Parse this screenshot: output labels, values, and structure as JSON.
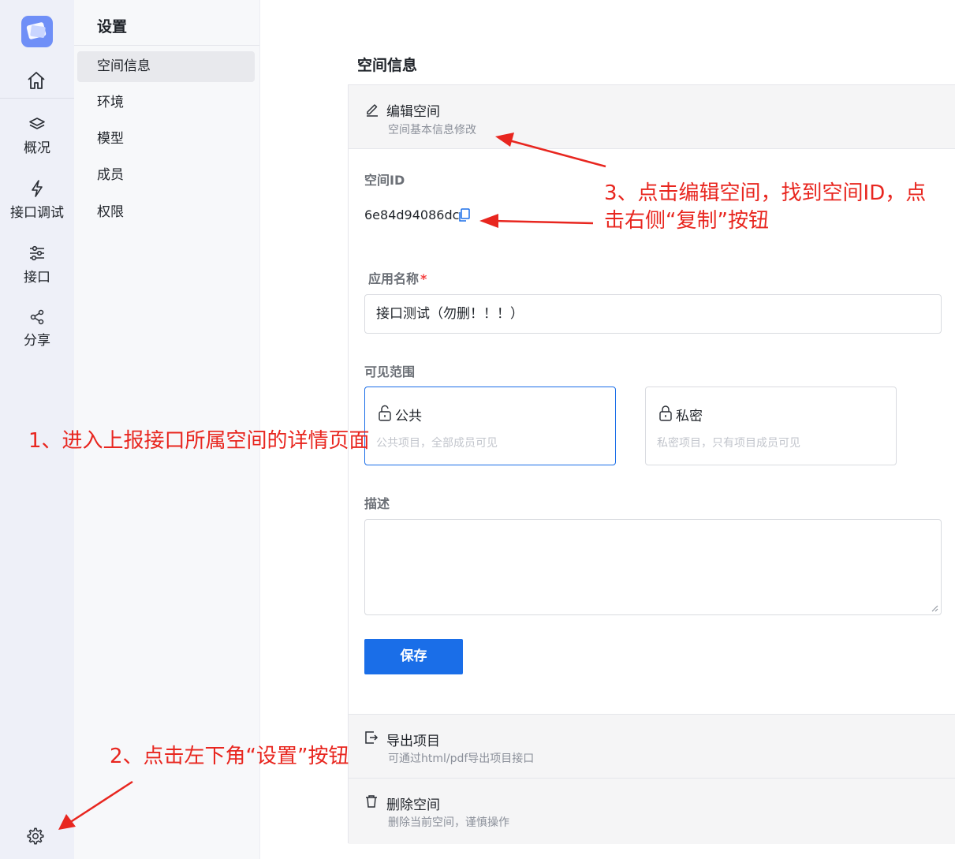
{
  "rail": {
    "items": [
      {
        "icon": "layers-icon",
        "label": "概况"
      },
      {
        "icon": "lightning-icon",
        "label": "接口调试"
      },
      {
        "icon": "sliders-icon",
        "label": "接口"
      },
      {
        "icon": "share-icon",
        "label": "分享"
      }
    ]
  },
  "submenu": {
    "title": "设置",
    "items": [
      {
        "label": "空间信息",
        "active": true
      },
      {
        "label": "环境"
      },
      {
        "label": "模型"
      },
      {
        "label": "成员"
      },
      {
        "label": "权限"
      }
    ]
  },
  "main": {
    "page_title": "空间信息",
    "edit_section": {
      "title": "编辑空间",
      "desc": "空间基本信息修改"
    },
    "space_id_label": "空间ID",
    "space_id_value": "6e84d94086dc",
    "app_name_label": "应用名称",
    "app_name_required": "*",
    "app_name_value": "接口测试（勿删！！！）",
    "visibility_label": "可见范围",
    "visibility_options": [
      {
        "title": "公共",
        "desc": "公共项目，全部成员可见",
        "selected": true
      },
      {
        "title": "私密",
        "desc": "私密项目，只有项目成员可见",
        "selected": false
      }
    ],
    "description_label": "描述",
    "save_label": "保存",
    "export_section": {
      "title": "导出项目",
      "desc": "可通过html/pdf导出项目接口"
    },
    "delete_section": {
      "title": "删除空间",
      "desc": "删除当前空间，谨慎操作"
    }
  },
  "annotations": {
    "step1": "1、进入上报接口所属空间的详情页面",
    "step2": "2、点击左下角“设置”按钮",
    "step3_line1": "3、点击编辑空间，找到空间ID，点",
    "step3_line2": "击右侧“复制”按钮",
    "color": "#e8261f"
  },
  "colors": {
    "primary": "#1a6ee8",
    "rail_bg": "#eef0f8",
    "submenu_bg": "#f7f8fa",
    "logo": "#6f8ff7"
  }
}
